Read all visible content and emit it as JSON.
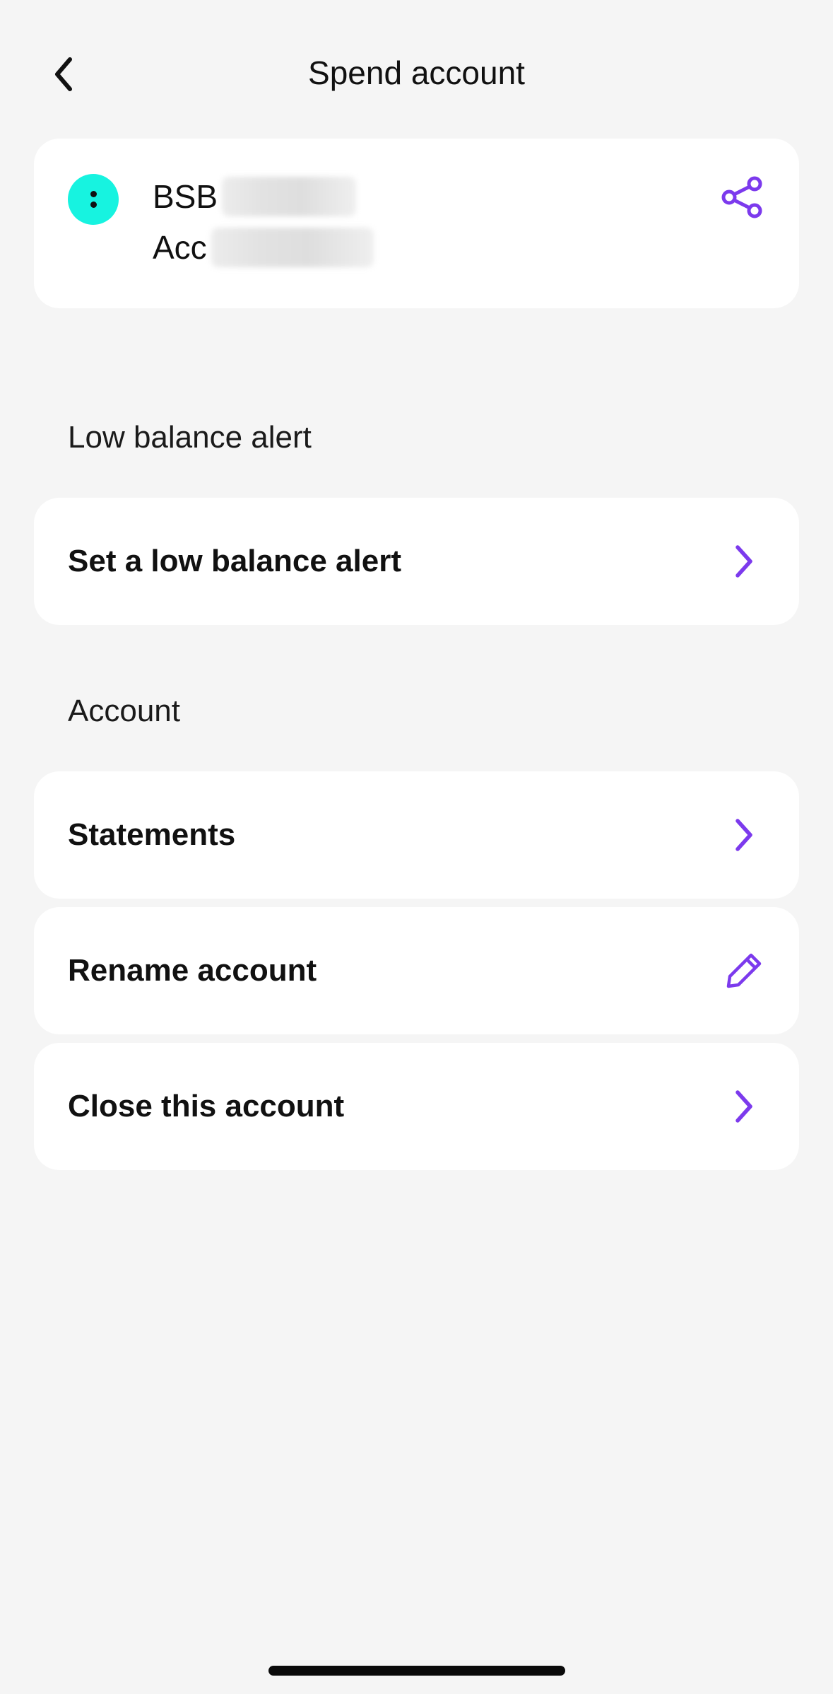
{
  "header": {
    "title": "Spend account"
  },
  "account_card": {
    "bsb_label": "BSB",
    "acc_label": "Acc"
  },
  "low_balance": {
    "section_label": "Low balance alert",
    "row_label": "Set a low balance alert"
  },
  "account_section": {
    "section_label": "Account",
    "rows": [
      {
        "label": "Statements",
        "icon": "chevron-right-icon"
      },
      {
        "label": "Rename account",
        "icon": "pencil-icon"
      },
      {
        "label": "Close this account",
        "icon": "chevron-right-icon"
      }
    ]
  },
  "colors": {
    "accent": "#7c3aed",
    "avatar": "#17f3e0",
    "background": "#f5f5f5",
    "card": "#ffffff"
  }
}
